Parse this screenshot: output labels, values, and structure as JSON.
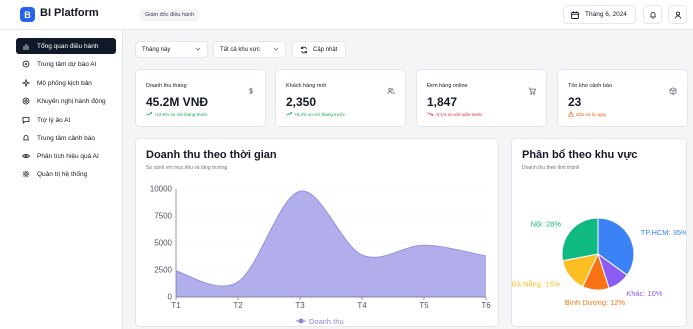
{
  "header": {
    "logo_letter": "B",
    "brand": "BI Platform",
    "role_badge": "Giám đốc điều hành",
    "date_label": "Tháng 6, 2024"
  },
  "sidebar": {
    "items": [
      {
        "label": "Tổng quan điều hành",
        "icon": "chart-icon",
        "active": true
      },
      {
        "label": "Trung tâm dự báo AI",
        "icon": "forecast-icon"
      },
      {
        "label": "Mô phỏng kịch bản",
        "icon": "sparkle-icon"
      },
      {
        "label": "Khuyến nghị hành động",
        "icon": "target-icon"
      },
      {
        "label": "Trợ lý ảo AI",
        "icon": "chat-icon"
      },
      {
        "label": "Trung tâm cảnh báo",
        "icon": "bell-icon"
      },
      {
        "label": "Phân tích hiệu quả AI",
        "icon": "eye-icon"
      },
      {
        "label": "Quản trị hệ thống",
        "icon": "gear-icon"
      }
    ]
  },
  "filters": {
    "period": "Tháng này",
    "region": "Tất cả khu vực",
    "refresh_label": "Cập nhật"
  },
  "kpis": [
    {
      "label": "Doanh thu tháng",
      "value": "45.2M VNĐ",
      "change": "+12.5% so với tháng trước",
      "trend": "up",
      "icon": "dollar-icon"
    },
    {
      "label": "Khách hàng mới",
      "value": "2,350",
      "change": "+8.2% so với tháng trước",
      "trend": "up",
      "icon": "users-icon"
    },
    {
      "label": "Đơn hàng online",
      "value": "1,847",
      "change": "-3.1% so với tuần trước",
      "trend": "down",
      "icon": "cart-icon"
    },
    {
      "label": "Tồn kho cảnh báo",
      "value": "23",
      "change": "Cần xử lý ngay",
      "trend": "warn",
      "icon": "box-icon"
    }
  ],
  "colors": {
    "up": "#16a34a",
    "down": "#dc2626",
    "warn": "#ea580c",
    "area_fill": "#a5a0e8",
    "area_stroke": "#8b85de"
  },
  "revenue_card": {
    "title": "Doanh thu theo thời gian",
    "subtitle": "So sánh với mục tiêu và tăng trưởng"
  },
  "region_card": {
    "title": "Phân bổ theo khu vực",
    "subtitle": "Doanh thu theo tỉnh thành"
  },
  "chart_data": [
    {
      "type": "area",
      "x": [
        "T1",
        "T2",
        "T3",
        "T4",
        "T5",
        "T6"
      ],
      "series": [
        {
          "name": "Doanh thu",
          "values": [
            2400,
            1400,
            9800,
            3900,
            4800,
            3800
          ]
        }
      ],
      "ylim": [
        0,
        10000
      ],
      "yticks": [
        0,
        2500,
        5000,
        7500,
        10000
      ],
      "grid": true,
      "legend": "bottom"
    },
    {
      "type": "pie",
      "slices": [
        {
          "label": "TP.HCM",
          "value": 35,
          "color": "#3b82f6"
        },
        {
          "label": "Khác",
          "value": 10,
          "color": "#8b5cf6"
        },
        {
          "label": "Bình Dương",
          "value": 12,
          "color": "#f97316"
        },
        {
          "label": "Đà Nẵng",
          "value": 15,
          "color": "#fbbf24"
        },
        {
          "label": "Nội",
          "value": 28,
          "color": "#10b981"
        }
      ]
    }
  ]
}
